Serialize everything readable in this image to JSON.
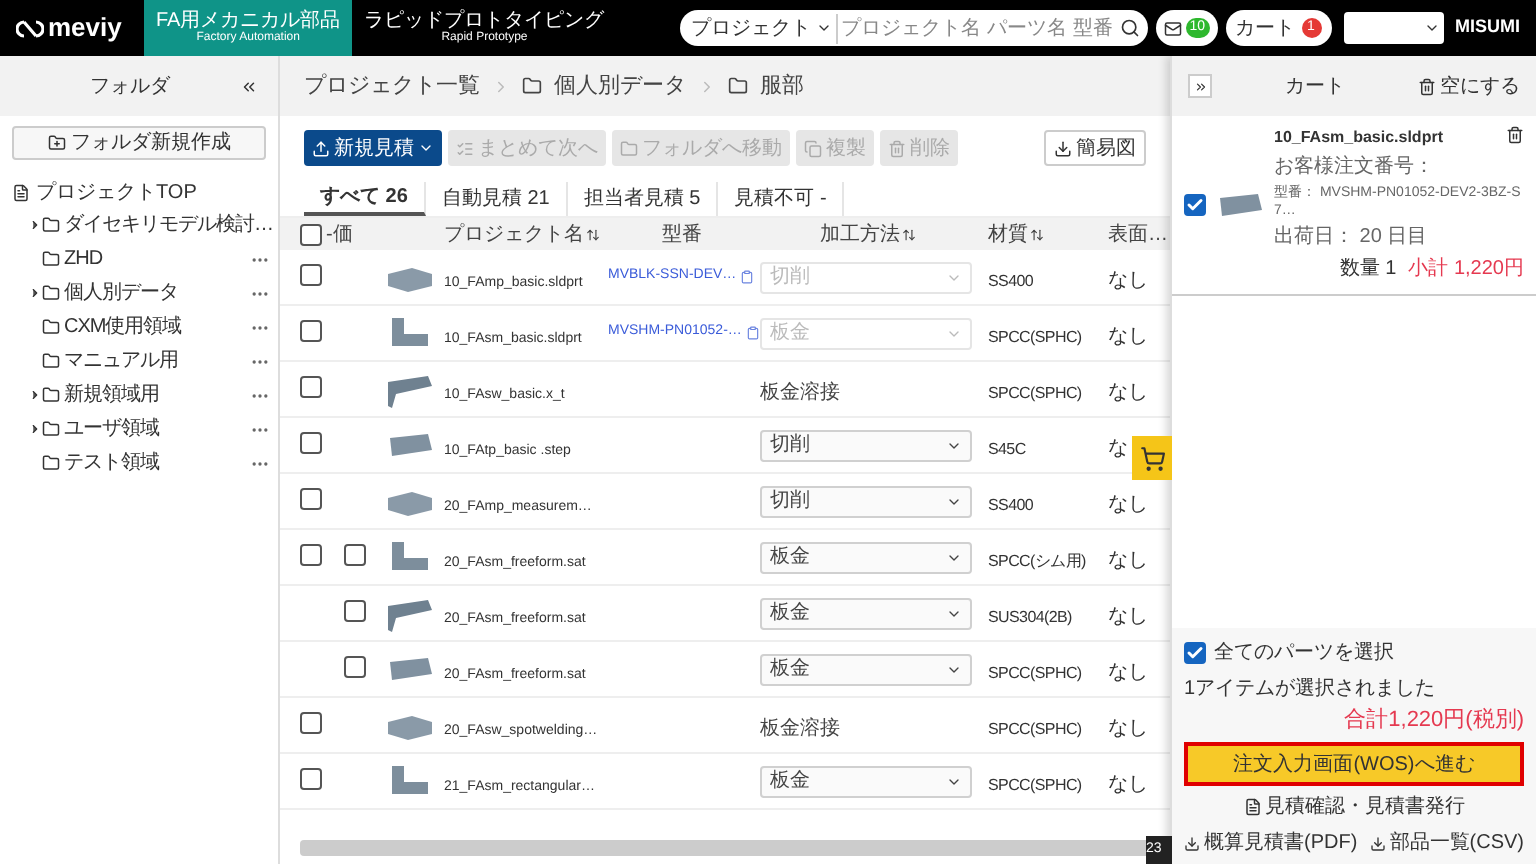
{
  "header": {
    "logo": "meviy",
    "tabs": [
      {
        "label": "FA用メカニカル部品",
        "sub": "Factory Automation",
        "selected": true
      },
      {
        "label": "ラピッドプロトタイピング",
        "sub": "Rapid Prototype",
        "selected": false
      }
    ],
    "search": {
      "scope": "プロジェクト",
      "placeholder": "プロジェクト名 パーツ名 型番"
    },
    "mail_count": "10",
    "cart_label": "カート",
    "cart_count": "1",
    "brand": "MISUMI"
  },
  "sidebar": {
    "title": "フォルダ",
    "new_folder": "フォルダ新規作成",
    "root": "プロジェクトTOP",
    "items": [
      {
        "label": "ダイセキリモデル検討…",
        "has_children": true
      },
      {
        "label": "ZHD",
        "has_children": false
      },
      {
        "label": "個人別データ",
        "has_children": true
      },
      {
        "label": "CXM使用領域",
        "has_children": false
      },
      {
        "label": "マニュアル用",
        "has_children": false
      },
      {
        "label": "新規領域用",
        "has_children": true
      },
      {
        "label": "ユーザ領域",
        "has_children": true
      },
      {
        "label": "テスト領域",
        "has_children": false
      }
    ]
  },
  "breadcrumb": [
    {
      "label": "プロジェクト一覧",
      "kind": "link"
    },
    {
      "label": "個人別データ",
      "kind": "folder"
    },
    {
      "label": "服部",
      "kind": "folder"
    }
  ],
  "toolbar": [
    {
      "label": "新規見積",
      "kind": "primary",
      "disabled": false
    },
    {
      "label": "まとめて次へ",
      "kind": "list",
      "disabled": true
    },
    {
      "label": "フォルダへ移動",
      "kind": "folder",
      "disabled": true
    },
    {
      "label": "複製",
      "kind": "copy",
      "disabled": true
    },
    {
      "label": "削除",
      "kind": "trash",
      "disabled": true
    }
  ],
  "export_button": "簡易図",
  "tabs": [
    {
      "label": "すべて",
      "count": "26",
      "selected": true
    },
    {
      "label": "自動見積",
      "count": "21",
      "selected": false
    },
    {
      "label": "担当者見積",
      "count": "5",
      "selected": false
    },
    {
      "label": "見積不可",
      "count": "-",
      "selected": false
    }
  ],
  "table": {
    "select_all_checked": false,
    "columns": [
      "-価",
      "プロジェクト名",
      "型番",
      "加工方法",
      "材質",
      "表面…"
    ],
    "rows": [
      {
        "kind": "single",
        "checked": false,
        "name": "10_FAmp_basic.sldprt",
        "model": "MVBLK-SSN-DEV…",
        "method": {
          "kind": "select",
          "label": "切削",
          "disabled": true
        },
        "material": "SS400",
        "surface": "なし"
      },
      {
        "kind": "single",
        "checked": false,
        "name": "10_FAsm_basic.sldprt",
        "model": "MVSHM-PN01052-…",
        "method": {
          "kind": "select",
          "label": "板金",
          "disabled": true
        },
        "material": "SPCC(SPHC)",
        "surface": "なし"
      },
      {
        "kind": "single",
        "checked": false,
        "name": "10_FAsw_basic.x_t",
        "method": {
          "kind": "text",
          "label": "板金溶接"
        },
        "material": "SPCC(SPHC)",
        "surface": "なし"
      },
      {
        "kind": "single",
        "checked": false,
        "name": "10_FAtp_basic .step",
        "method": {
          "kind": "select",
          "label": "切削",
          "disabled": false
        },
        "material": "S45C",
        "surface": "な"
      },
      {
        "kind": "single",
        "checked": false,
        "name": "20_FAmp_measurem…",
        "method": {
          "kind": "select",
          "label": "切削",
          "disabled": false
        },
        "material": "SS400",
        "surface": "なし"
      },
      {
        "kind": "parent",
        "checked": false,
        "sub_checked": false,
        "name": "20_FAsm_freeform.sat",
        "method": {
          "kind": "select",
          "label": "板金",
          "disabled": false
        },
        "material": "SPCC(シム用)",
        "surface": "なし"
      },
      {
        "kind": "child",
        "sub_checked": false,
        "name": "20_FAsm_freeform.sat",
        "method": {
          "kind": "select",
          "label": "板金",
          "disabled": false
        },
        "material": "SUS304(2B)",
        "surface": "なし"
      },
      {
        "kind": "child",
        "sub_checked": false,
        "name": "20_FAsm_freeform.sat",
        "method": {
          "kind": "select",
          "label": "板金",
          "disabled": false
        },
        "material": "SPCC(SPHC)",
        "surface": "なし"
      },
      {
        "kind": "single",
        "checked": false,
        "name": "20_FAsw_spotwelding…",
        "method": {
          "kind": "text",
          "label": "板金溶接"
        },
        "material": "SPCC(SPHC)",
        "surface": "なし"
      },
      {
        "kind": "single",
        "checked": false,
        "name": "21_FAsm_rectangular…",
        "method": {
          "kind": "select",
          "label": "板金",
          "disabled": false
        },
        "material": "SPCC(SPHC)",
        "surface": "なし"
      }
    ]
  },
  "tooltip": "23",
  "cart": {
    "title": "カート",
    "empty": "空にする",
    "items": [
      {
        "checked": true,
        "name": "10_FAsm_basic.sldprt",
        "order_label": "お客様注文番号：",
        "model": "型番： MVSHM-PN01052-DEV2-3BZ-S7…",
        "ship": "出荷日： 20 日目",
        "qty": "数量 1",
        "subtotal": "小計 1,220円"
      }
    ],
    "select_all": {
      "label": "全てのパーツを選択",
      "checked": true
    },
    "selected_text": "1アイテムが選択されました",
    "total": "合計1,220円(税別)",
    "order_button": "注文入力画面(WOS)へ進む",
    "confirm": "見積確認・見積書発行",
    "downloads": [
      "概算見積書(PDF)",
      "部品一覧(CSV)"
    ]
  }
}
